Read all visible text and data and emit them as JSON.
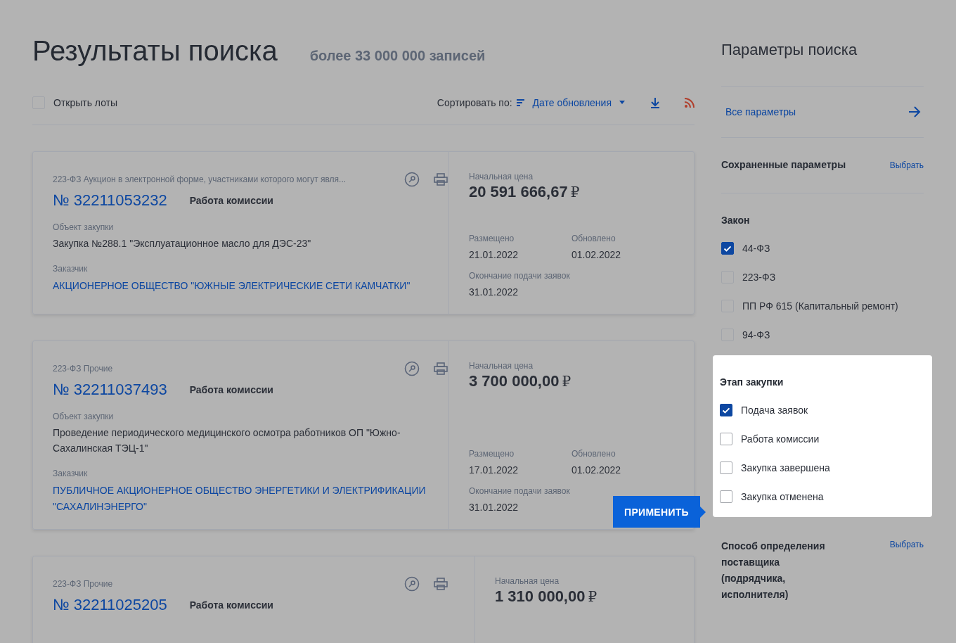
{
  "header": {
    "title": "Результаты поиска",
    "count": "более 33 000 000 записей"
  },
  "toolbar": {
    "open_lots": {
      "label": "Открыть лоты",
      "checked": false
    },
    "sort_label": "Сортировать по:",
    "sort_value": "Дате обновления"
  },
  "results": [
    {
      "category": "223-ФЗ Аукцион в электронной форме, участниками которого могут явля...",
      "number": "№ 32211053232",
      "status": "Работа комиссии",
      "object_label": "Объект закупки",
      "object": "Закупка №288.1 \"Эксплуатационное масло для ДЭС-23\"",
      "customer_label": "Заказчик",
      "customer": "АКЦИОНЕРНОЕ ОБЩЕСТВО \"ЮЖНЫЕ ЭЛЕКТРИЧЕСКИЕ СЕТИ КАМЧАТКИ\"",
      "price_label": "Начальная цена",
      "price": "20 591 666,67",
      "currency": "₽",
      "posted_label": "Размещено",
      "posted": "21.01.2022",
      "updated_label": "Обновлено",
      "updated": "01.02.2022",
      "deadline_label": "Окончание подачи заявок",
      "deadline": "31.01.2022"
    },
    {
      "category": "223-ФЗ Прочие",
      "number": "№ 32211037493",
      "status": "Работа комиссии",
      "object_label": "Объект закупки",
      "object": "Проведение периодического медицинского осмотра работников ОП \"Южно-Сахалинская ТЭЦ-1\"",
      "customer_label": "Заказчик",
      "customer": "ПУБЛИЧНОЕ АКЦИОНЕРНОЕ ОБЩЕСТВО ЭНЕРГЕТИКИ И ЭЛЕКТРИФИКАЦИИ \"САХАЛИНЭНЕРГО\"",
      "price_label": "Начальная цена",
      "price": "3 700 000,00",
      "currency": "₽",
      "posted_label": "Размещено",
      "posted": "17.01.2022",
      "updated_label": "Обновлено",
      "updated": "01.02.2022",
      "deadline_label": "Окончание подачи заявок",
      "deadline": "31.01.2022"
    },
    {
      "category": "223-ФЗ Прочие",
      "number": "№ 32211025205",
      "status": "Работа комиссии",
      "price_label": "Начальная цена",
      "price": "1 310 000,00",
      "currency": "₽"
    }
  ],
  "apply_button": "ПРИМЕНИТЬ",
  "sidebar": {
    "title": "Параметры поиска",
    "all_params": "Все параметры",
    "saved_label": "Сохраненные параметры",
    "saved_action": "Выбрать",
    "groups": [
      {
        "title": "Закон",
        "highlighted": false,
        "options": [
          {
            "label": "44-ФЗ",
            "checked": true
          },
          {
            "label": "223-ФЗ",
            "checked": false
          },
          {
            "label": "ПП РФ 615 (Капитальный ремонт)",
            "checked": false
          },
          {
            "label": "94-ФЗ",
            "checked": false
          }
        ]
      },
      {
        "title": "Этап закупки",
        "highlighted": true,
        "options": [
          {
            "label": "Подача заявок",
            "checked": true
          },
          {
            "label": "Работа комиссии",
            "checked": false
          },
          {
            "label": "Закупка завершена",
            "checked": false
          },
          {
            "label": "Закупка отменена",
            "checked": false
          }
        ]
      }
    ],
    "method": {
      "title": "Способ определения поставщика (подрядчика, исполнителя)",
      "action": "Выбрать"
    }
  }
}
